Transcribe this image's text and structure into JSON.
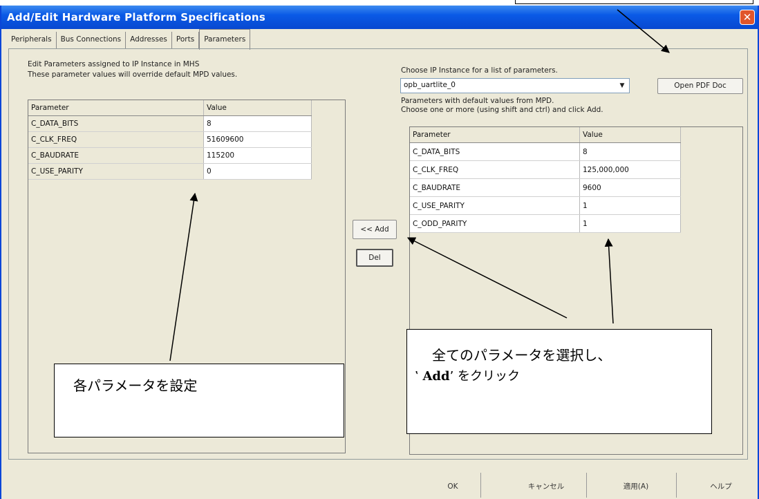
{
  "window": {
    "title": "Add/Edit Hardware Platform Specifications",
    "close_icon": "close-icon"
  },
  "tabs": [
    "Peripherals",
    "Bus Connections",
    "Addresses",
    "Ports",
    "Parameters"
  ],
  "left_panel": {
    "note_line1": "Edit Parameters assigned to IP Instance in MHS",
    "note_line2": "These parameter values will override default MPD values.",
    "header": {
      "parameter": "Parameter",
      "value": "Value"
    },
    "rows": [
      {
        "name": "C_DATA_BITS",
        "value": "8"
      },
      {
        "name": "C_CLK_FREQ",
        "value": "51609600"
      },
      {
        "name": "C_BAUDRATE",
        "value": "115200"
      },
      {
        "name": "C_USE_PARITY",
        "value": "0"
      }
    ]
  },
  "middle": {
    "add_label": "<< Add",
    "del_label": "Del"
  },
  "right_panel": {
    "choose_label": "Choose IP Instance for a list of parameters.",
    "instance_value": "opb_uartlite_0",
    "open_pdf_label": "Open PDF Doc",
    "info_line1": "Parameters with default values from MPD.",
    "info_line2": "Choose one or more (using shift and ctrl) and click Add.",
    "header": {
      "parameter": "Parameter",
      "value": "Value"
    },
    "rows": [
      {
        "name": "C_DATA_BITS",
        "value": "8"
      },
      {
        "name": "C_CLK_FREQ",
        "value": "125,000,000"
      },
      {
        "name": "C_BAUDRATE",
        "value": "9600"
      },
      {
        "name": "C_USE_PARITY",
        "value": "1"
      },
      {
        "name": "C_ODD_PARITY",
        "value": "1"
      }
    ]
  },
  "footer": {
    "ok": "OK",
    "cancel": "キャンセル",
    "apply": "適用(A)",
    "help": "ヘルプ"
  },
  "callouts": {
    "left": "各パラメータを設定",
    "right_line1": "全てのパラメータを選択し、",
    "right_line2_prefix": "‛ ",
    "right_line2_bold": "Add",
    "right_line2_suffix": "’ をクリック"
  }
}
